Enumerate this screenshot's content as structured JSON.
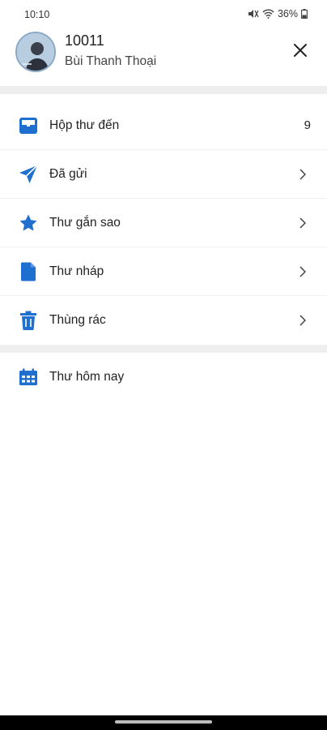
{
  "status_bar": {
    "time": "10:10",
    "battery": "36%"
  },
  "profile": {
    "account_number": "10011",
    "name": "Bùi Thanh Thoại"
  },
  "menu": {
    "items": [
      {
        "label": "Hộp thư đến",
        "count": "9",
        "icon": "inbox-icon"
      },
      {
        "label": "Đã gửi",
        "icon": "send-icon"
      },
      {
        "label": "Thư gắn sao",
        "icon": "star-icon"
      },
      {
        "label": "Thư nháp",
        "icon": "draft-icon"
      },
      {
        "label": "Thùng rác",
        "icon": "trash-icon"
      }
    ],
    "secondary": [
      {
        "label": "Thư hôm nay",
        "icon": "calendar-icon"
      }
    ]
  },
  "colors": {
    "accent": "#1e6fd0",
    "divider": "#eeeeee"
  }
}
